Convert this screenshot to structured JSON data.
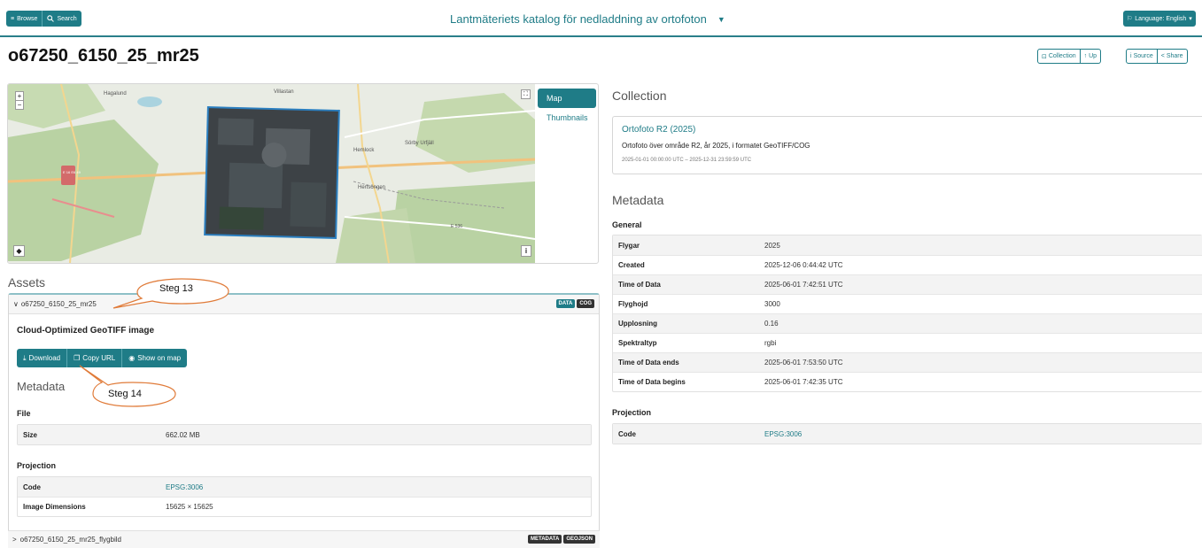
{
  "nav": {
    "browse_label": "Browse",
    "search_label": "Search",
    "site_title": "Lantmäteriets katalog för nedladdning av ortofoton",
    "language_label": "Language: English"
  },
  "page": {
    "title": "o67250_6150_25_mr25",
    "actions": {
      "collection": "Collection",
      "up": "Up",
      "source": "Source",
      "share": "Share"
    }
  },
  "map": {
    "tab_map": "Map",
    "tab_thumbnails": "Thumbnails",
    "labels": [
      "Hagalund",
      "Villastan",
      "Hemlock",
      "Sörby Urfjäll",
      "Hertsöngen",
      "E 16 E6 49",
      "E 536"
    ]
  },
  "assets": {
    "heading": "Assets",
    "asset1": {
      "name": "o67250_6150_25_mr25",
      "badges": [
        "DATA",
        "COG"
      ],
      "type_title": "Cloud-Optimized GeoTIFF image",
      "download_label": "Download",
      "copy_url_label": "Copy URL",
      "show_on_map_label": "Show on map",
      "metadata_heading": "Metadata",
      "file_heading": "File",
      "file_rows": [
        {
          "key": "Size",
          "value": "662.02 MB"
        }
      ],
      "projection_heading": "Projection",
      "projection_rows": [
        {
          "key": "Code",
          "value": "EPSG:3006"
        },
        {
          "key": "Image Dimensions",
          "value": "15625 × 15625"
        }
      ]
    },
    "asset2": {
      "name": "o67250_6150_25_mr25_flygbild",
      "badges": [
        "METADATA",
        "GEOJSON"
      ]
    }
  },
  "callouts": {
    "step13": "Steg 13",
    "step14": "Steg 14"
  },
  "collection": {
    "heading": "Collection",
    "title": "Ortofoto R2 (2025)",
    "description": "Ortofoto över område R2, år 2025, i formatet GeoTIFF/COG",
    "time_range": "2025-01-01 00:00:00 UTC – 2025-12-31 23:59:59 UTC"
  },
  "metadata": {
    "heading": "Metadata",
    "general_heading": "General",
    "general_rows": [
      {
        "key": "Flygar",
        "value": "2025"
      },
      {
        "key": "Created",
        "value": "2025-12-06 0:44:42 UTC"
      },
      {
        "key": "Time of Data",
        "value": "2025-06-01 7:42:51 UTC"
      },
      {
        "key": "Flyghojd",
        "value": "3000"
      },
      {
        "key": "Upplosning",
        "value": "0.16"
      },
      {
        "key": "Spektraltyp",
        "value": "rgbi"
      },
      {
        "key": "Time of Data ends",
        "value": "2025-06-01 7:53:50 UTC"
      },
      {
        "key": "Time of Data begins",
        "value": "2025-06-01 7:42:35 UTC"
      }
    ],
    "projection_heading": "Projection",
    "projection_rows": [
      {
        "key": "Code",
        "value": "EPSG:3006"
      }
    ]
  },
  "colors": {
    "accent": "#1f7c87",
    "callout_stroke": "#e07b39"
  }
}
